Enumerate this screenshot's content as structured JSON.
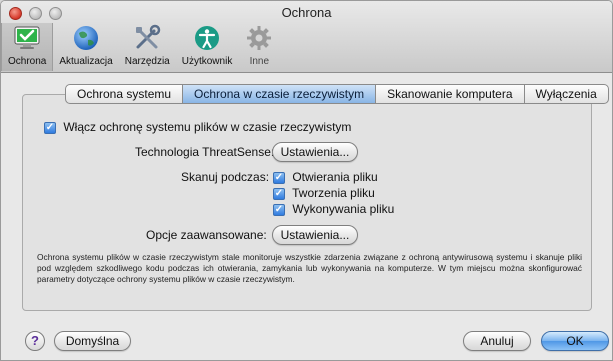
{
  "window": {
    "title": "Ochrona"
  },
  "toolbar": {
    "items": [
      {
        "label": "Ochrona",
        "icon": "monitor-check-icon"
      },
      {
        "label": "Aktualizacja",
        "icon": "globe-icon"
      },
      {
        "label": "Narzędzia",
        "icon": "tools-icon"
      },
      {
        "label": "Użytkownik",
        "icon": "accessibility-person-icon"
      },
      {
        "label": "Inne",
        "icon": "gear-icon"
      }
    ]
  },
  "tabs": [
    {
      "label": "Ochrona systemu"
    },
    {
      "label": "Ochrona w czasie rzeczywistym"
    },
    {
      "label": "Skanowanie komputera"
    },
    {
      "label": "Wyłączenia"
    }
  ],
  "panel": {
    "enable_checkbox_label": "Włącz ochronę systemu plików w czasie rzeczywistym",
    "threatsense_label": "Technologia ThreatSense:",
    "threatsense_button": "Ustawienia...",
    "scan_label": "Skanuj podczas:",
    "scan_options": [
      {
        "label": "Otwierania pliku",
        "checked": true
      },
      {
        "label": "Tworzenia pliku",
        "checked": true
      },
      {
        "label": "Wykonywania pliku",
        "checked": true
      }
    ],
    "advanced_label": "Opcje zaawansowane:",
    "advanced_button": "Ustawienia...",
    "description": "Ochrona systemu plików w czasie rzeczywistym stale monitoruje wszystkie zdarzenia związane z ochroną antywirusową systemu i skanuje pliki pod względem szkodliwego kodu podczas ich otwierania, zamykania lub wykonywania na komputerze. W tym miejscu można skonfigurować parametry dotyczące ochrony systemu plików w czasie rzeczywistym."
  },
  "footer": {
    "help_symbol": "?",
    "defaults_button": "Domyślna",
    "cancel_button": "Anuluj",
    "ok_button": "OK"
  },
  "colors": {
    "accent": "#5a9de6",
    "selected_tab": "#89b5e6"
  }
}
